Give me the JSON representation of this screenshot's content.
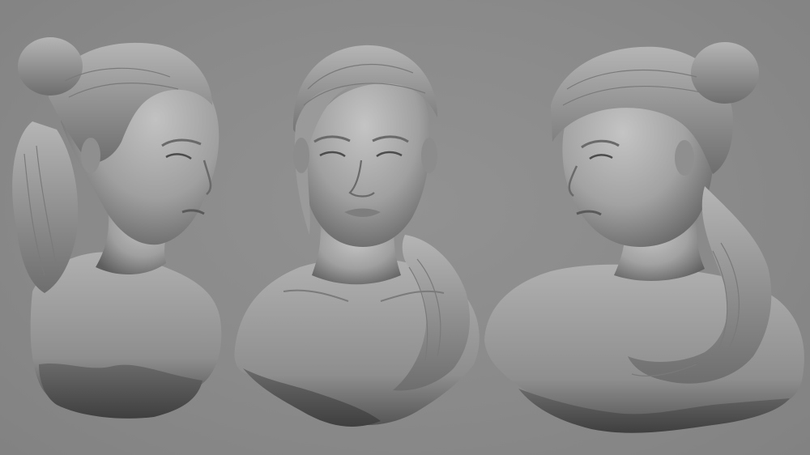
{
  "scene": {
    "background_color": "#8a8a8a",
    "material_color": "#a6a6a6",
    "views": [
      {
        "id": "left-three-quarter-view",
        "facing": "right"
      },
      {
        "id": "front-view",
        "facing": "front"
      },
      {
        "id": "right-three-quarter-view",
        "facing": "left"
      }
    ]
  }
}
